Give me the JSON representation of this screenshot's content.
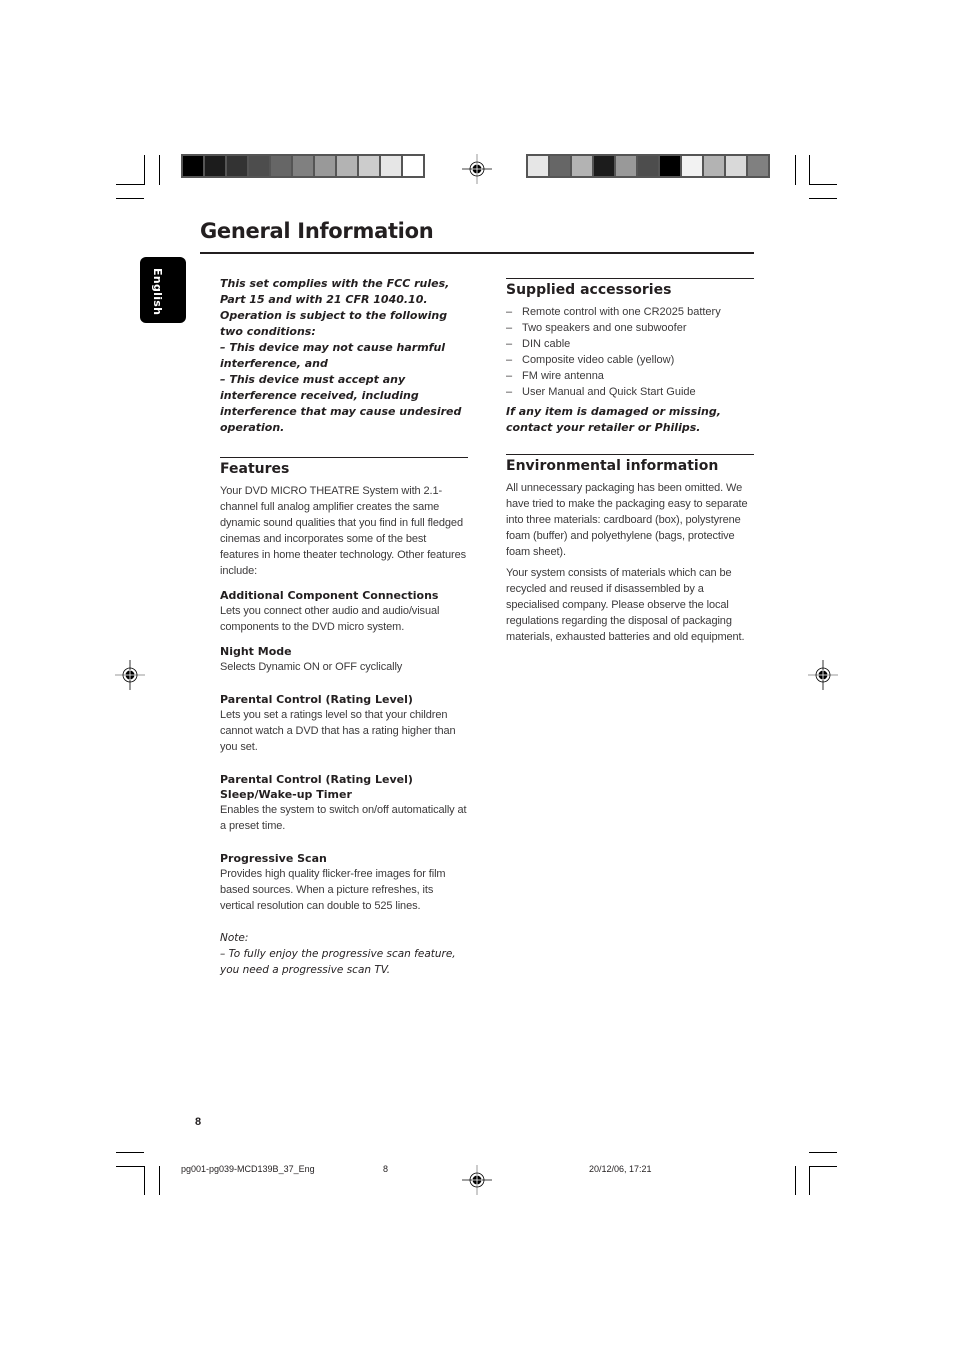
{
  "print_marks": {
    "left_swatches": [
      "#000000",
      "#1c1c1c",
      "#333333",
      "#4d4d4d",
      "#666666",
      "#808080",
      "#999999",
      "#b3b3b3",
      "#cccccc",
      "#e6e6e6",
      "#ffffff"
    ],
    "right_swatches": [
      "#e6e6e6",
      "#666666",
      "#b3b3b3",
      "#1c1c1c",
      "#999999",
      "#4d4d4d",
      "#000000",
      "#f2f2f2",
      "#b3b3b3",
      "#d9d9d9",
      "#808080"
    ]
  },
  "header": {
    "title": "General Information",
    "language_tab": "English"
  },
  "fcc": {
    "lines": [
      "This set complies with the FCC rules,",
      "Part 15 and with 21 CFR 1040.10.",
      "Operation is subject to the following two conditions:"
    ],
    "conditions": [
      "–   This device may not cause harmful interference, and",
      "–   This device must accept any interference received, including interference that may cause undesired operation."
    ]
  },
  "features": {
    "heading": "Features",
    "intro": "Your DVD MICRO THEATRE System  with 2.1-channel full analog amplifier creates the same dynamic sound qualities that you find in full fledged cinemas and incorporates some of the best features in home theater technology. Other features include:",
    "items": [
      {
        "title": "Additional Component Connections",
        "text": "Lets you connect other audio and audio/visual components to the DVD micro system."
      },
      {
        "title": "Night Mode",
        "text": "Selects Dynamic ON or OFF cyclically"
      },
      {
        "title": "Parental Control (Rating Level)",
        "text": "Lets you set a ratings level so that your children cannot watch a DVD that has a rating higher than you set."
      },
      {
        "title": "Parental Control (Rating Level)",
        "title2": "Sleep/Wake-up Timer",
        "text": "Enables the system to switch on/off automatically at a preset time."
      },
      {
        "title": "Progressive Scan",
        "text": "Provides high quality flicker-free images for film based sources. When a picture refreshes, its vertical resolution can double to 525 lines."
      }
    ],
    "note_label": "Note:",
    "note_text": "–  To fully enjoy the progressive scan feature, you need a progressive scan TV."
  },
  "accessories": {
    "heading": "Supplied accessories",
    "dash": "–",
    "items": [
      "Remote control with one CR2025 battery",
      "Two speakers and one subwoofer",
      "DIN cable",
      "Composite video cable (yellow)",
      "FM wire antenna",
      "User Manual and Quick Start Guide"
    ],
    "warning": "If any item is damaged or missing, contact your retailer or Philips."
  },
  "environmental": {
    "heading": "Environmental information",
    "paragraphs": [
      "All unnecessary packaging has been omitted. We have tried to make the packaging easy to separate into three materials: cardboard (box), polystyrene foam (buffer) and polyethylene (bags, protective foam sheet).",
      "Your system consists of materials which can be recycled and reused if disassembled by a specialised company. Please observe the local regulations regarding the disposal of packaging materials, exhausted batteries and old equipment."
    ]
  },
  "footer": {
    "page_number": "8",
    "file_name": "pg001-pg039-MCD139B_37_Eng",
    "file_page": "8",
    "timestamp": "20/12/06, 17:21"
  }
}
